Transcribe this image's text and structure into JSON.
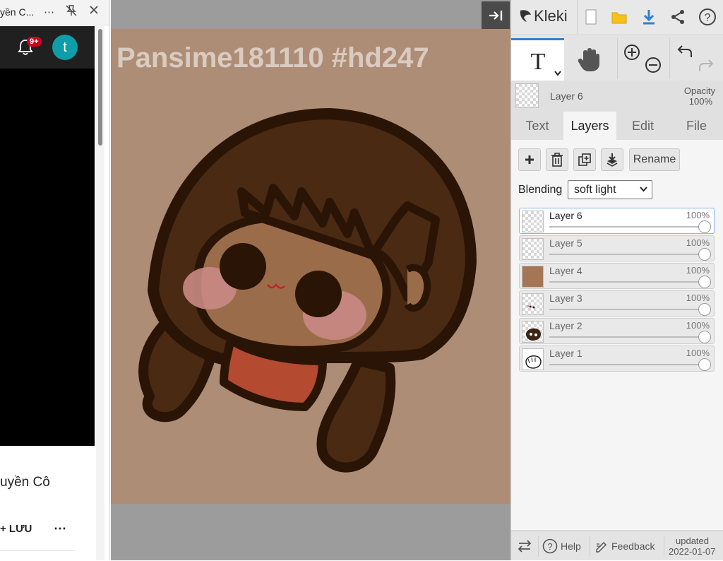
{
  "browser_panel": {
    "tab_title": "yền C...",
    "tab_more": "⋯",
    "notification_badge": "9+",
    "avatar_letter": "t",
    "video_caption": "uyền Cô",
    "save_label": "+ LƯU",
    "more_label": "⋯"
  },
  "canvas": {
    "watermark": "Pansime181110 #hd247",
    "background_color": "#ad8d76"
  },
  "kleki": {
    "app_name": "Kleki",
    "tools": [
      "text-tool",
      "hand-tool",
      "zoom-in",
      "zoom-out",
      "undo",
      "redo"
    ],
    "current_layer": {
      "name": "Layer 6",
      "opacity_label": "Opacity",
      "opacity_value": "100%"
    },
    "tabs": [
      {
        "label": "Text",
        "active": false
      },
      {
        "label": "Layers",
        "active": true
      },
      {
        "label": "Edit",
        "active": false
      },
      {
        "label": "File",
        "active": false
      }
    ],
    "rename_label": "Rename",
    "blending_label": "Blending",
    "blending_value": "soft light",
    "layers": [
      {
        "name": "Layer 6",
        "opacity": "100%",
        "selected": true
      },
      {
        "name": "Layer 5",
        "opacity": "100%",
        "selected": false
      },
      {
        "name": "Layer 4",
        "opacity": "100%",
        "selected": false
      },
      {
        "name": "Layer 3",
        "opacity": "100%",
        "selected": false
      },
      {
        "name": "Layer 2",
        "opacity": "100%",
        "selected": false
      },
      {
        "name": "Layer 1",
        "opacity": "100%",
        "selected": false
      }
    ],
    "footer": {
      "help": "Help",
      "feedback": "Feedback",
      "updated_label": "updated",
      "updated_date": "2022-01-07"
    }
  },
  "colors": {
    "accent_blue": "#2e80d1",
    "badge_red": "#d0021b",
    "avatar_teal": "#0f9ea8",
    "folder_yellow": "#f5c21b"
  }
}
